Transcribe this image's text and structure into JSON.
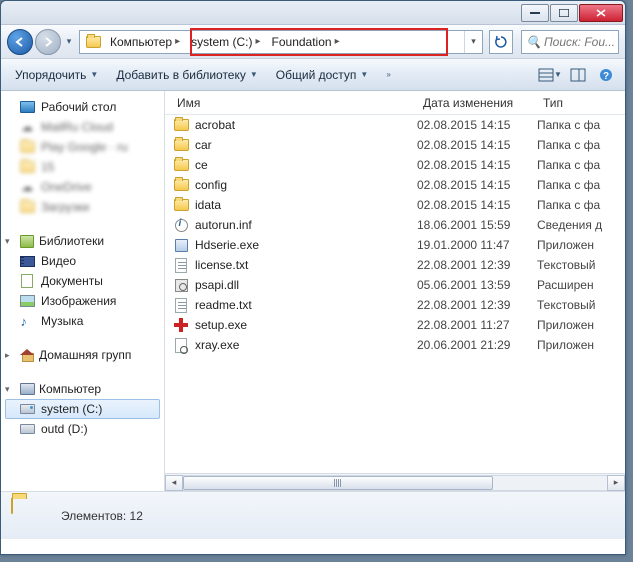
{
  "breadcrumb": {
    "computer": "Компьютер",
    "drive": "system (C:)",
    "folder": "Foundation"
  },
  "search": {
    "placeholder": "Поиск: Fou..."
  },
  "toolbar": {
    "organize": "Упорядочить",
    "addlib": "Добавить в библиотеку",
    "share": "Общий доступ"
  },
  "sidebar": {
    "desktop": "Рабочий стол",
    "blur1": "MailRu Cloud",
    "blur2": "Play Google · ru",
    "blur3": "15",
    "blur4": "OneDrive",
    "blur5": "Загрузки",
    "libs": "Библиотеки",
    "video": "Видео",
    "docs": "Документы",
    "images": "Изображения",
    "music": "Музыка",
    "homegrp": "Домашняя групп",
    "computer": "Компьютер",
    "drive_c": "system (C:)",
    "drive_d": "outd (D:)"
  },
  "columns": {
    "name": "Имя",
    "date": "Дата изменения",
    "type": "Тип"
  },
  "files": [
    {
      "name": "acrobat",
      "date": "02.08.2015 14:15",
      "type": "Папка с фа",
      "icon": "folder"
    },
    {
      "name": "car",
      "date": "02.08.2015 14:15",
      "type": "Папка с фа",
      "icon": "folder"
    },
    {
      "name": "ce",
      "date": "02.08.2015 14:15",
      "type": "Папка с фа",
      "icon": "folder"
    },
    {
      "name": "config",
      "date": "02.08.2015 14:15",
      "type": "Папка с фа",
      "icon": "folder"
    },
    {
      "name": "idata",
      "date": "02.08.2015 14:15",
      "type": "Папка с фа",
      "icon": "folder"
    },
    {
      "name": "autorun.inf",
      "date": "18.06.2001 15:59",
      "type": "Сведения д",
      "icon": "inf"
    },
    {
      "name": "Hdserie.exe",
      "date": "19.01.2000 11:47",
      "type": "Приложен",
      "icon": "exe"
    },
    {
      "name": "license.txt",
      "date": "22.08.2001 12:39",
      "type": "Текстовый",
      "icon": "txt"
    },
    {
      "name": "psapi.dll",
      "date": "05.06.2001 13:59",
      "type": "Расширен",
      "icon": "dll"
    },
    {
      "name": "readme.txt",
      "date": "22.08.2001 12:39",
      "type": "Текстовый",
      "icon": "txt"
    },
    {
      "name": "setup.exe",
      "date": "22.08.2001 11:27",
      "type": "Приложен",
      "icon": "setup"
    },
    {
      "name": "xray.exe",
      "date": "20.06.2001 21:29",
      "type": "Приложен",
      "icon": "search"
    }
  ],
  "status": {
    "label": "Элементов:",
    "count": "12"
  }
}
